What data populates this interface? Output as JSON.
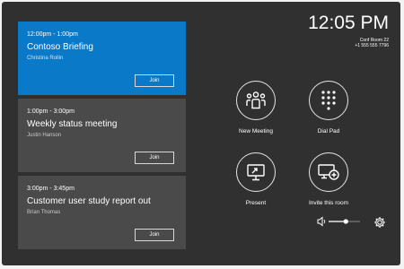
{
  "meetings": [
    {
      "time": "12:00pm - 1:00pm",
      "title": "Contoso Briefing",
      "organizer": "Christina Rollin",
      "join_label": "Join",
      "active": true
    },
    {
      "time": "1:00pm - 3:00pm",
      "title": "Weekly status meeting",
      "organizer": "Justin Hanson",
      "join_label": "Join",
      "active": false
    },
    {
      "time": "3:00pm - 3:45pm",
      "title": "Customer user study report out",
      "organizer": "Brian Thomas",
      "join_label": "Join",
      "active": false
    }
  ],
  "status": {
    "clock": "12:05 PM",
    "room_name": "Conf Room 22",
    "room_phone": "+1 555 555 7796"
  },
  "actions": {
    "new_meeting": "New Meeting",
    "dial_pad": "Dial Pad",
    "present": "Present",
    "invite": "Invite this room"
  },
  "controls": {
    "volume_level": 0.55
  },
  "colors": {
    "background": "#303030",
    "card": "#4a4a4a",
    "active_card": "#0a79c7"
  }
}
